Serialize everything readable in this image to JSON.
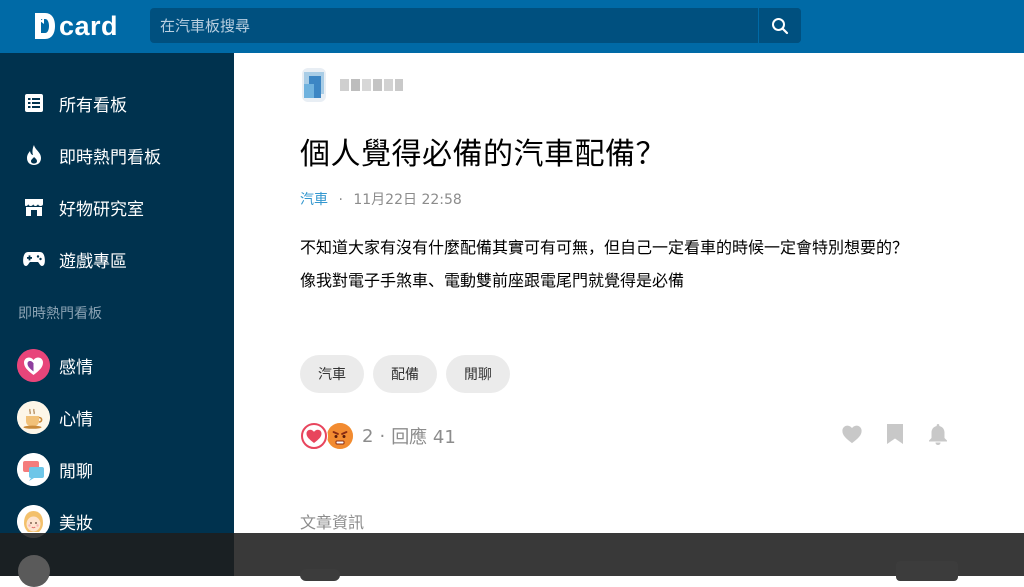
{
  "app": {
    "logo_text": "card"
  },
  "search": {
    "placeholder": "在汽車板搜尋"
  },
  "sidebar": {
    "nav": [
      {
        "label": "所有看板",
        "icon": "list-icon"
      },
      {
        "label": "即時熱門看板",
        "icon": "fire-icon"
      },
      {
        "label": "好物研究室",
        "icon": "store-icon"
      },
      {
        "label": "遊戲專區",
        "icon": "gamepad-icon"
      }
    ],
    "section_title": "即時熱門看板",
    "boards": [
      {
        "label": "感情",
        "icon": "heart-board-icon"
      },
      {
        "label": "心情",
        "icon": "coffee-board-icon"
      },
      {
        "label": "閒聊",
        "icon": "chat-board-icon"
      },
      {
        "label": "美妝",
        "icon": "makeup-board-icon"
      }
    ]
  },
  "post": {
    "title": "個人覺得必備的汽車配備？",
    "forum": "汽車",
    "separator": "·",
    "date": "11月22日 22:58",
    "body_line1": "不知道大家有沒有什麼配備其實可有可無，但自己一定看車的時候一定會特別想要的？",
    "body_line2": "像我對電子手煞車、電動雙前座跟電尾門就覺得是必備",
    "tags": [
      "汽車",
      "配備",
      "閒聊"
    ],
    "reaction_count": "2",
    "reply_text": "回應 41",
    "reply_sep": "·",
    "section_info": "文章資訊"
  },
  "colors": {
    "topbar": "#006aa6",
    "sidebar": "#00324e",
    "accent_link": "#3397cf"
  }
}
